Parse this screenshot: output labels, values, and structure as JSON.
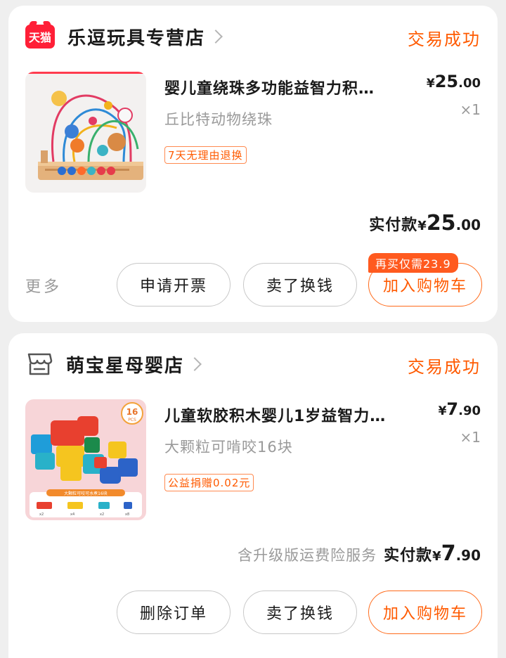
{
  "orders": [
    {
      "shop_name": "乐逗玩具专营店",
      "shop_badge": "天猫",
      "status": "交易成功",
      "product_title": "婴儿童绕珠多功能益智力积…",
      "sku": "丘比特动物绕珠",
      "tag": "7天无理由退换",
      "price_symbol": "¥",
      "price_int": "25",
      "price_dec": ".00",
      "quantity": "×1",
      "paid_label": "实付款",
      "paid_symbol": "¥",
      "paid_int": "25",
      "paid_dec": ".00",
      "more_label": "更多",
      "buttons": [
        "申请开票",
        "卖了换钱",
        "加入购物车"
      ],
      "rebuy_badge": "再买仅需23.9"
    },
    {
      "shop_name": "萌宝星母婴店",
      "status": "交易成功",
      "product_title": "儿童软胶积木婴儿1岁益智力…",
      "sku": "大颗粒可啃咬16块",
      "tag": "公益捐赠0.02元",
      "price_symbol": "¥",
      "price_int": "7",
      "price_dec": ".90",
      "quantity": "×1",
      "insurance": "含升级版运费险服务",
      "paid_label": "实付款",
      "paid_symbol": "¥",
      "paid_int": "7",
      "paid_dec": ".90",
      "buttons": [
        "删除订单",
        "卖了换钱",
        "加入购物车"
      ],
      "image_badge_num": "16",
      "image_badge_unit": "PCS",
      "image_caption": "大颗粒可咬可水煮16块",
      "image_counts": [
        "x2",
        "x4",
        "x2",
        "x8"
      ]
    }
  ],
  "colors": {
    "accent": "#ff5a00",
    "tmall_red": "#ff1f37",
    "muted": "#9a9a9a",
    "background": "#efefef"
  }
}
